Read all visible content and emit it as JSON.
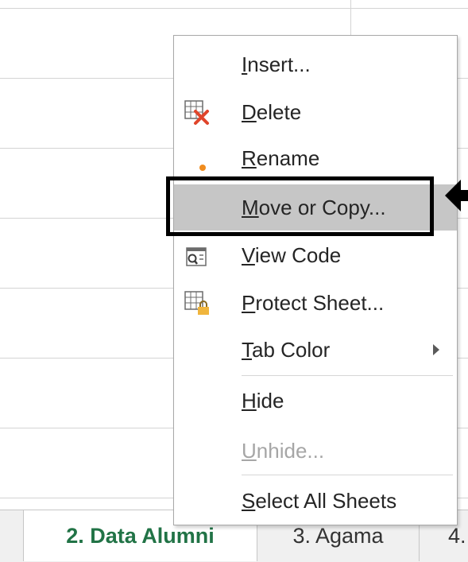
{
  "sheet_tabs": [
    {
      "label": "",
      "active": false
    },
    {
      "label": "2. Data Alumni",
      "active": true
    },
    {
      "label": "3. Agama",
      "active": false
    },
    {
      "label": "4.",
      "active": false
    }
  ],
  "context_menu": {
    "items": [
      {
        "mnemonic": "I",
        "rest": "nsert...",
        "icon": "none",
        "disabled": false
      },
      {
        "mnemonic": "D",
        "rest": "elete",
        "icon": "delete-sheet-icon",
        "disabled": false
      },
      {
        "mnemonic": "R",
        "rest": "ename",
        "icon": "rename-dot-icon",
        "disabled": false
      },
      {
        "mnemonic": "M",
        "rest": "ove or Copy...",
        "icon": "none",
        "disabled": false,
        "highlighted": true
      },
      {
        "mnemonic": "V",
        "rest": "iew Code",
        "icon": "view-code-icon",
        "disabled": false
      },
      {
        "mnemonic": "P",
        "rest": "rotect Sheet...",
        "icon": "protect-sheet-icon",
        "disabled": false
      },
      {
        "mnemonic": "T",
        "rest": "ab Color",
        "icon": "none",
        "disabled": false,
        "submenu": true
      },
      {
        "mnemonic": "H",
        "rest": "ide",
        "icon": "none",
        "disabled": false
      },
      {
        "mnemonic": "U",
        "rest": "nhide...",
        "icon": "none",
        "disabled": true
      },
      {
        "mnemonic": "S",
        "rest": "elect All Sheets",
        "icon": "none",
        "disabled": false
      }
    ]
  },
  "colors": {
    "active_tab_text": "#217346",
    "highlight": "#c6c6c6",
    "delete_x": "#e0452b",
    "rename_dot": "#f08c1e",
    "lock": "#f0b53d"
  }
}
